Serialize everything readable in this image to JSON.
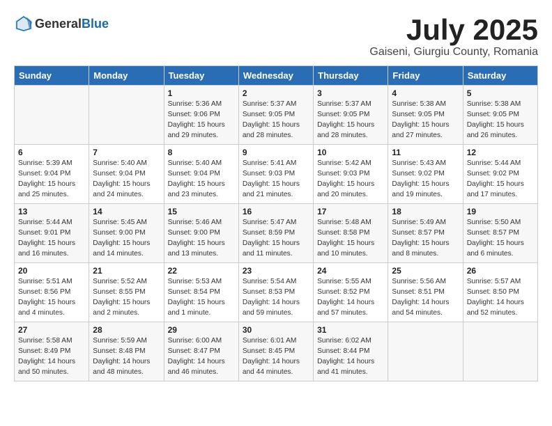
{
  "logo": {
    "general": "General",
    "blue": "Blue"
  },
  "title": "July 2025",
  "location": "Gaiseni, Giurgiu County, Romania",
  "days_of_week": [
    "Sunday",
    "Monday",
    "Tuesday",
    "Wednesday",
    "Thursday",
    "Friday",
    "Saturday"
  ],
  "weeks": [
    [
      {
        "day": "",
        "sunrise": "",
        "sunset": "",
        "daylight": ""
      },
      {
        "day": "",
        "sunrise": "",
        "sunset": "",
        "daylight": ""
      },
      {
        "day": "1",
        "sunrise": "Sunrise: 5:36 AM",
        "sunset": "Sunset: 9:06 PM",
        "daylight": "Daylight: 15 hours and 29 minutes."
      },
      {
        "day": "2",
        "sunrise": "Sunrise: 5:37 AM",
        "sunset": "Sunset: 9:05 PM",
        "daylight": "Daylight: 15 hours and 28 minutes."
      },
      {
        "day": "3",
        "sunrise": "Sunrise: 5:37 AM",
        "sunset": "Sunset: 9:05 PM",
        "daylight": "Daylight: 15 hours and 28 minutes."
      },
      {
        "day": "4",
        "sunrise": "Sunrise: 5:38 AM",
        "sunset": "Sunset: 9:05 PM",
        "daylight": "Daylight: 15 hours and 27 minutes."
      },
      {
        "day": "5",
        "sunrise": "Sunrise: 5:38 AM",
        "sunset": "Sunset: 9:05 PM",
        "daylight": "Daylight: 15 hours and 26 minutes."
      }
    ],
    [
      {
        "day": "6",
        "sunrise": "Sunrise: 5:39 AM",
        "sunset": "Sunset: 9:04 PM",
        "daylight": "Daylight: 15 hours and 25 minutes."
      },
      {
        "day": "7",
        "sunrise": "Sunrise: 5:40 AM",
        "sunset": "Sunset: 9:04 PM",
        "daylight": "Daylight: 15 hours and 24 minutes."
      },
      {
        "day": "8",
        "sunrise": "Sunrise: 5:40 AM",
        "sunset": "Sunset: 9:04 PM",
        "daylight": "Daylight: 15 hours and 23 minutes."
      },
      {
        "day": "9",
        "sunrise": "Sunrise: 5:41 AM",
        "sunset": "Sunset: 9:03 PM",
        "daylight": "Daylight: 15 hours and 21 minutes."
      },
      {
        "day": "10",
        "sunrise": "Sunrise: 5:42 AM",
        "sunset": "Sunset: 9:03 PM",
        "daylight": "Daylight: 15 hours and 20 minutes."
      },
      {
        "day": "11",
        "sunrise": "Sunrise: 5:43 AM",
        "sunset": "Sunset: 9:02 PM",
        "daylight": "Daylight: 15 hours and 19 minutes."
      },
      {
        "day": "12",
        "sunrise": "Sunrise: 5:44 AM",
        "sunset": "Sunset: 9:02 PM",
        "daylight": "Daylight: 15 hours and 17 minutes."
      }
    ],
    [
      {
        "day": "13",
        "sunrise": "Sunrise: 5:44 AM",
        "sunset": "Sunset: 9:01 PM",
        "daylight": "Daylight: 15 hours and 16 minutes."
      },
      {
        "day": "14",
        "sunrise": "Sunrise: 5:45 AM",
        "sunset": "Sunset: 9:00 PM",
        "daylight": "Daylight: 15 hours and 14 minutes."
      },
      {
        "day": "15",
        "sunrise": "Sunrise: 5:46 AM",
        "sunset": "Sunset: 9:00 PM",
        "daylight": "Daylight: 15 hours and 13 minutes."
      },
      {
        "day": "16",
        "sunrise": "Sunrise: 5:47 AM",
        "sunset": "Sunset: 8:59 PM",
        "daylight": "Daylight: 15 hours and 11 minutes."
      },
      {
        "day": "17",
        "sunrise": "Sunrise: 5:48 AM",
        "sunset": "Sunset: 8:58 PM",
        "daylight": "Daylight: 15 hours and 10 minutes."
      },
      {
        "day": "18",
        "sunrise": "Sunrise: 5:49 AM",
        "sunset": "Sunset: 8:57 PM",
        "daylight": "Daylight: 15 hours and 8 minutes."
      },
      {
        "day": "19",
        "sunrise": "Sunrise: 5:50 AM",
        "sunset": "Sunset: 8:57 PM",
        "daylight": "Daylight: 15 hours and 6 minutes."
      }
    ],
    [
      {
        "day": "20",
        "sunrise": "Sunrise: 5:51 AM",
        "sunset": "Sunset: 8:56 PM",
        "daylight": "Daylight: 15 hours and 4 minutes."
      },
      {
        "day": "21",
        "sunrise": "Sunrise: 5:52 AM",
        "sunset": "Sunset: 8:55 PM",
        "daylight": "Daylight: 15 hours and 2 minutes."
      },
      {
        "day": "22",
        "sunrise": "Sunrise: 5:53 AM",
        "sunset": "Sunset: 8:54 PM",
        "daylight": "Daylight: 15 hours and 1 minute."
      },
      {
        "day": "23",
        "sunrise": "Sunrise: 5:54 AM",
        "sunset": "Sunset: 8:53 PM",
        "daylight": "Daylight: 14 hours and 59 minutes."
      },
      {
        "day": "24",
        "sunrise": "Sunrise: 5:55 AM",
        "sunset": "Sunset: 8:52 PM",
        "daylight": "Daylight: 14 hours and 57 minutes."
      },
      {
        "day": "25",
        "sunrise": "Sunrise: 5:56 AM",
        "sunset": "Sunset: 8:51 PM",
        "daylight": "Daylight: 14 hours and 54 minutes."
      },
      {
        "day": "26",
        "sunrise": "Sunrise: 5:57 AM",
        "sunset": "Sunset: 8:50 PM",
        "daylight": "Daylight: 14 hours and 52 minutes."
      }
    ],
    [
      {
        "day": "27",
        "sunrise": "Sunrise: 5:58 AM",
        "sunset": "Sunset: 8:49 PM",
        "daylight": "Daylight: 14 hours and 50 minutes."
      },
      {
        "day": "28",
        "sunrise": "Sunrise: 5:59 AM",
        "sunset": "Sunset: 8:48 PM",
        "daylight": "Daylight: 14 hours and 48 minutes."
      },
      {
        "day": "29",
        "sunrise": "Sunrise: 6:00 AM",
        "sunset": "Sunset: 8:47 PM",
        "daylight": "Daylight: 14 hours and 46 minutes."
      },
      {
        "day": "30",
        "sunrise": "Sunrise: 6:01 AM",
        "sunset": "Sunset: 8:45 PM",
        "daylight": "Daylight: 14 hours and 44 minutes."
      },
      {
        "day": "31",
        "sunrise": "Sunrise: 6:02 AM",
        "sunset": "Sunset: 8:44 PM",
        "daylight": "Daylight: 14 hours and 41 minutes."
      },
      {
        "day": "",
        "sunrise": "",
        "sunset": "",
        "daylight": ""
      },
      {
        "day": "",
        "sunrise": "",
        "sunset": "",
        "daylight": ""
      }
    ]
  ]
}
